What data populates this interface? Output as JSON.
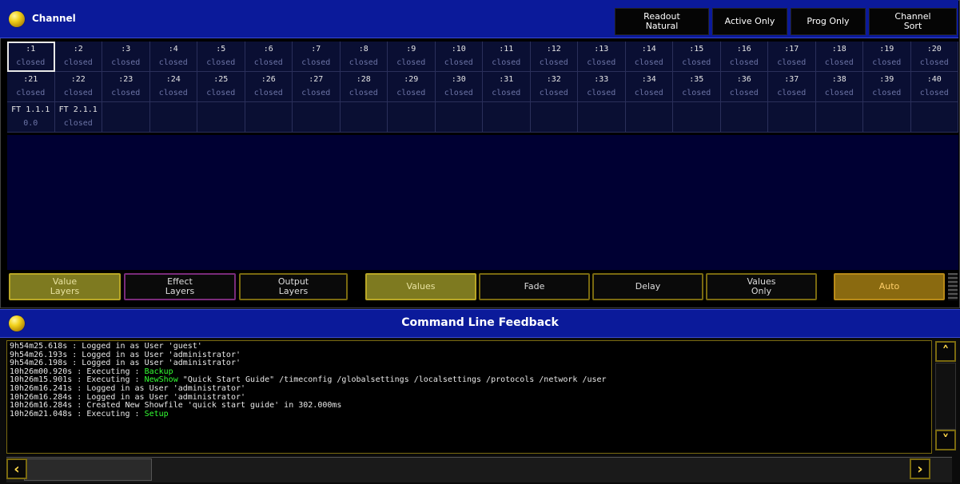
{
  "channel": {
    "title": "Channel",
    "toolbar": {
      "readout": "Readout\nNatural",
      "active_only": "Active Only",
      "prog_only": "Prog Only",
      "channel_sort": "Channel\nSort"
    },
    "cells": [
      {
        "num": ":1",
        "val": "closed"
      },
      {
        "num": ":2",
        "val": "closed"
      },
      {
        "num": ":3",
        "val": "closed"
      },
      {
        "num": ":4",
        "val": "closed"
      },
      {
        "num": ":5",
        "val": "closed"
      },
      {
        "num": ":6",
        "val": "closed"
      },
      {
        "num": ":7",
        "val": "closed"
      },
      {
        "num": ":8",
        "val": "closed"
      },
      {
        "num": ":9",
        "val": "closed"
      },
      {
        "num": ":10",
        "val": "closed"
      },
      {
        "num": ":11",
        "val": "closed"
      },
      {
        "num": ":12",
        "val": "closed"
      },
      {
        "num": ":13",
        "val": "closed"
      },
      {
        "num": ":14",
        "val": "closed"
      },
      {
        "num": ":15",
        "val": "closed"
      },
      {
        "num": ":16",
        "val": "closed"
      },
      {
        "num": ":17",
        "val": "closed"
      },
      {
        "num": ":18",
        "val": "closed"
      },
      {
        "num": ":19",
        "val": "closed"
      },
      {
        "num": ":20",
        "val": "closed"
      },
      {
        "num": ":21",
        "val": "closed"
      },
      {
        "num": ":22",
        "val": "closed"
      },
      {
        "num": ":23",
        "val": "closed"
      },
      {
        "num": ":24",
        "val": "closed"
      },
      {
        "num": ":25",
        "val": "closed"
      },
      {
        "num": ":26",
        "val": "closed"
      },
      {
        "num": ":27",
        "val": "closed"
      },
      {
        "num": ":28",
        "val": "closed"
      },
      {
        "num": ":29",
        "val": "closed"
      },
      {
        "num": ":30",
        "val": "closed"
      },
      {
        "num": ":31",
        "val": "closed"
      },
      {
        "num": ":32",
        "val": "closed"
      },
      {
        "num": ":33",
        "val": "closed"
      },
      {
        "num": ":34",
        "val": "closed"
      },
      {
        "num": ":35",
        "val": "closed"
      },
      {
        "num": ":36",
        "val": "closed"
      },
      {
        "num": ":37",
        "val": "closed"
      },
      {
        "num": ":38",
        "val": "closed"
      },
      {
        "num": ":39",
        "val": "closed"
      },
      {
        "num": ":40",
        "val": "closed"
      },
      {
        "num": "FT 1.1.1",
        "val": "0.0"
      },
      {
        "num": "FT 2.1.1",
        "val": "closed"
      }
    ],
    "layer_buttons": {
      "value_layers": "Value\nLayers",
      "effect_layers": "Effect\nLayers",
      "output_layers": "Output\nLayers",
      "values": "Values",
      "fade": "Fade",
      "delay": "Delay",
      "values_only": "Values\nOnly",
      "auto": "Auto"
    }
  },
  "command_line": {
    "title": "Command Line Feedback",
    "log": [
      {
        "text": "9h54m25.618s : Logged in as User 'guest'"
      },
      {
        "text": "9h54m26.193s : Logged in as User 'administrator'"
      },
      {
        "text": "9h54m26.198s : Logged in as User 'administrator'"
      },
      {
        "text": "10h26m00.920s : Executing : ",
        "hl": "Backup",
        "rest": ""
      },
      {
        "text": "10h26m15.901s : Executing : ",
        "hl": "NewShow",
        "rest": " \"Quick Start Guide\" /timeconfig /globalsettings /localsettings /protocols /network /user"
      },
      {
        "text": "10h26m16.241s : Logged in as User 'administrator'"
      },
      {
        "text": "10h26m16.284s : Logged in as User 'administrator'"
      },
      {
        "text": "10h26m16.284s : Created New Showfile 'quick start guide' in 302.000ms"
      },
      {
        "text": "10h26m21.048s : Executing : ",
        "hl": "Setup",
        "rest": ""
      }
    ]
  },
  "colors": {
    "titlebar": "#0b1a9a",
    "grid_bg": "#0a0f33",
    "accent_gold": "#b9a726",
    "log_highlight": "#33ff33"
  }
}
